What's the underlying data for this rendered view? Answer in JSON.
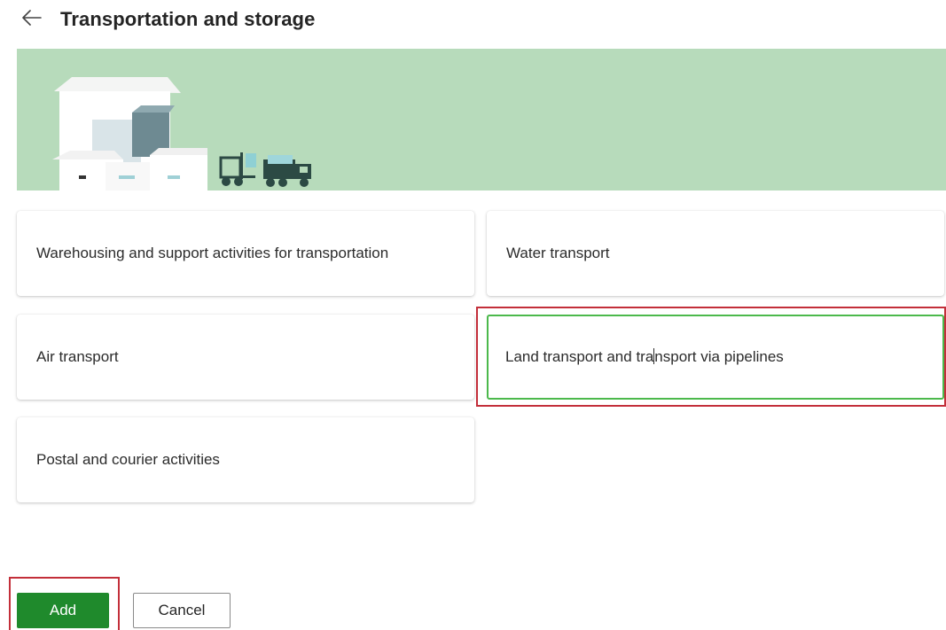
{
  "header": {
    "back_icon": "arrow-left-icon",
    "title": "Transportation and storage"
  },
  "banner": {
    "background_color": "#b7dbbb",
    "illustration": "warehouse-boxes-forklift-truck-illustration"
  },
  "options": [
    {
      "label": "Warehousing and support activities for transportation",
      "selected": false
    },
    {
      "label": "Water transport",
      "selected": false
    },
    {
      "label": "Air transport",
      "selected": false
    },
    {
      "label_part1": "Land transport and tra",
      "label_part2": "nsport via pipelines",
      "selected": true
    },
    {
      "label": "Postal and courier activities",
      "selected": false
    }
  ],
  "actions": {
    "add_label": "Add",
    "cancel_label": "Cancel"
  },
  "colors": {
    "primary": "#1f8a2c",
    "selected_border": "#4cb94c",
    "annotation": "#c32f3a"
  }
}
